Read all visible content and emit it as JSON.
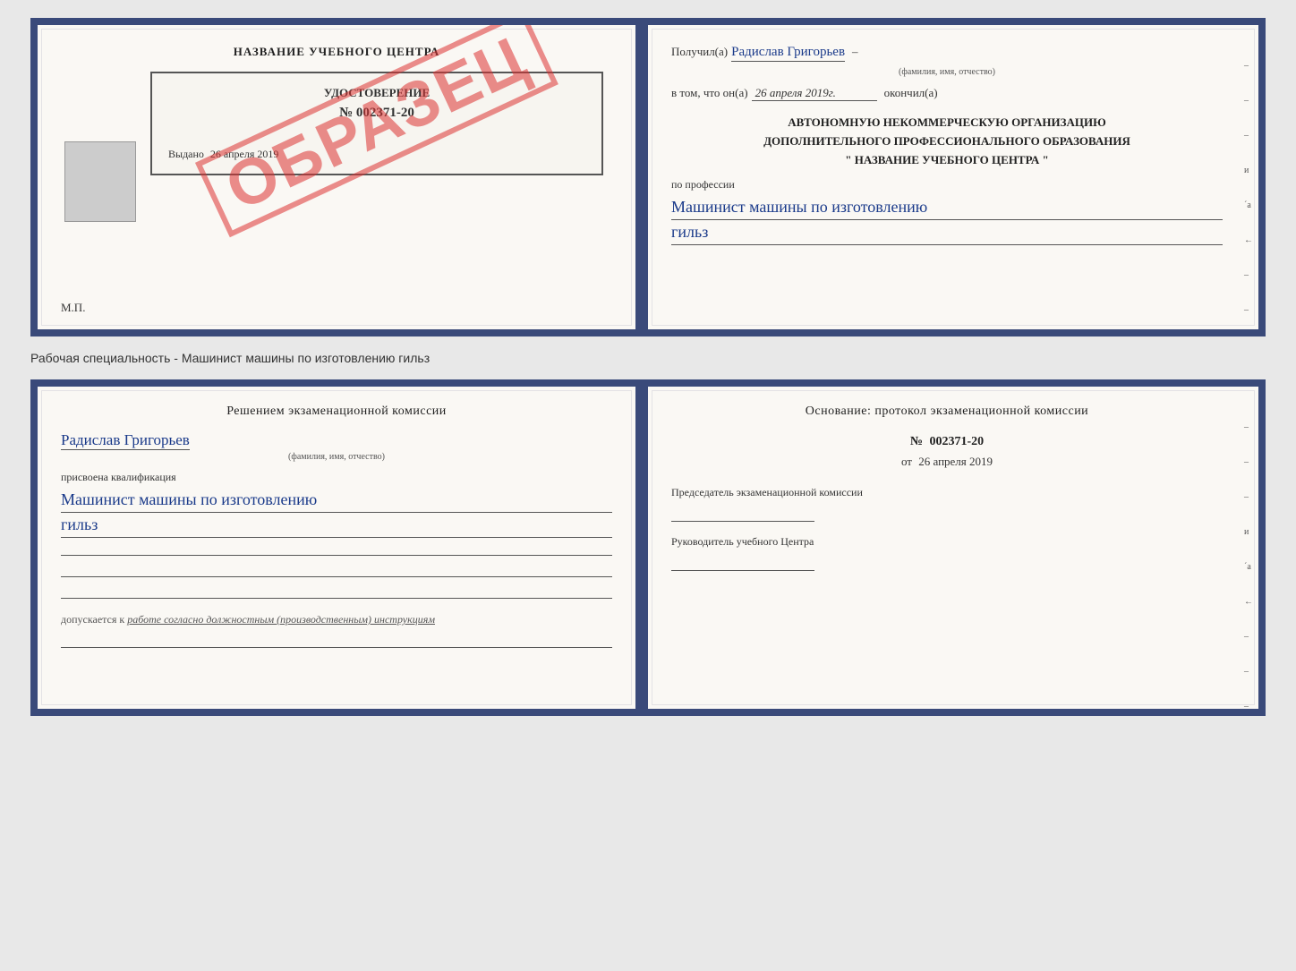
{
  "doc1": {
    "left": {
      "title": "НАЗВАНИЕ УЧЕБНОГО ЦЕНТРА",
      "cert_title": "УДОСТОВЕРЕНИЕ",
      "cert_number": "№ 002371-20",
      "issued_label": "Выдано",
      "issued_date": "26 апреля 2019",
      "stamp": "ОБРАЗЕЦ",
      "mp_label": "М.П."
    },
    "right": {
      "received_label": "Получил(а)",
      "person_name": "Радислав Григорьев",
      "name_note": "(фамилия, имя, отчество)",
      "in_that_label": "в том, что он(а)",
      "date_value": "26 апреля 2019г.",
      "finished_label": "окончил(а)",
      "org_line1": "АВТОНОМНУЮ НЕКОММЕРЧЕСКУЮ ОРГАНИЗАЦИЮ",
      "org_line2": "ДОПОЛНИТЕЛЬНОГО ПРОФЕССИОНАЛЬНОГО ОБРАЗОВАНИЯ",
      "org_line3": "\"  НАЗВАНИЕ УЧЕБНОГО ЦЕНТРА  \"",
      "profession_label": "по профессии",
      "profession_value": "Машинист машины по изготовлению",
      "profession_value2": "гильз"
    }
  },
  "label1": "Рабочая специальность - Машинист машины по изготовлению гильз",
  "doc2": {
    "left": {
      "header": "Решением  экзаменационной  комиссии",
      "person_name": "Радислав Григорьев",
      "name_note": "(фамилия, имя, отчество)",
      "assigned_label": "присвоена квалификация",
      "qualification1": "Машинист машины по изготовлению",
      "qualification2": "гильз",
      "dopusk_label": "допускается к",
      "dopusk_text": "работе согласно должностным (производственным) инструкциям"
    },
    "right": {
      "header": "Основание: протокол экзаменационной  комиссии",
      "number_label": "№",
      "number_value": "002371-20",
      "date_prefix": "от",
      "date_value": "26 апреля 2019",
      "chairman_label": "Председатель экзаменационной комиссии",
      "head_label": "Руководитель учебного Центра"
    }
  },
  "side_dashes": [
    "-",
    "-",
    "–",
    "и",
    "ʼа",
    "←",
    "–",
    "–",
    "–"
  ],
  "side_dashes2": [
    "-",
    "-",
    "–",
    "и",
    "ʼа",
    "←",
    "–",
    "–",
    "–"
  ]
}
